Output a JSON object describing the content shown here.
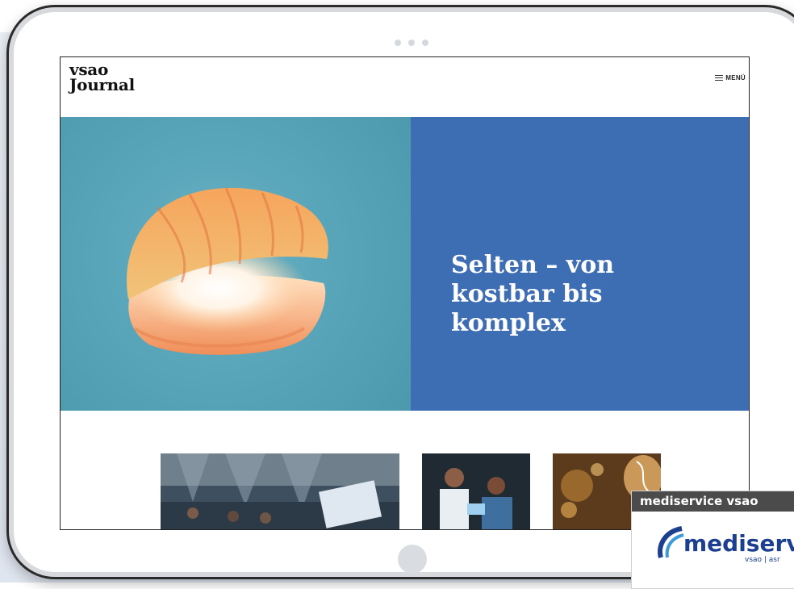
{
  "site": {
    "logo_line1": "vsao",
    "logo_line2": "Journal",
    "menu_label": "MENÜ"
  },
  "hero": {
    "title": "Selten – von kostbar bis komplex",
    "image_description_icon": "oyster-shell-illustration",
    "left_color": "#5aa6ba",
    "right_color": "#3d6db2"
  },
  "articles": [
    {
      "icon": "lecture-hall-photo"
    },
    {
      "icon": "doctors-tablet-photo"
    },
    {
      "icon": "glass-dna-photo"
    }
  ],
  "ad": {
    "label": "mediservice vsao",
    "logo_text": "mediservic",
    "tagline": "vsao | asr"
  }
}
